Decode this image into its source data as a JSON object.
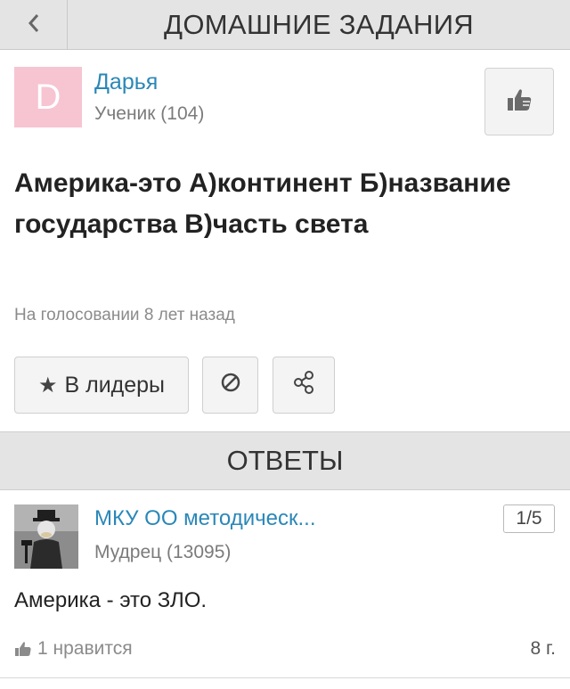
{
  "header": {
    "title": "ДОМАШНИЕ ЗАДАНИЯ",
    "back_icon": "chevron-left-icon"
  },
  "question": {
    "author": {
      "avatar_letter": "D",
      "avatar_color": "#f7c4d2",
      "name": "Дарья",
      "rank": "Ученик (104)"
    },
    "like_icon": "thumbs-up-icon",
    "text": "Америка-это А)континент Б)название государства В)часть света",
    "status": "На голосовании 8 лет назад",
    "actions": {
      "leaders_icon": "star-icon",
      "leaders_label": "В лидеры",
      "report_icon": "block-icon",
      "share_icon": "share-icon"
    }
  },
  "answers": {
    "header": "ОТВЕТЫ",
    "items": [
      {
        "author_name": "МКУ ОО методическ...",
        "author_rank": "Мудрец (13095)",
        "counter": "1/5",
        "text": "Америка - это ЗЛО.",
        "likes": "1 нравится",
        "age": "8 г."
      }
    ]
  },
  "colors": {
    "link": "#2a87b8",
    "header_bg": "#e4e4e4",
    "muted": "#8b8b8b"
  }
}
